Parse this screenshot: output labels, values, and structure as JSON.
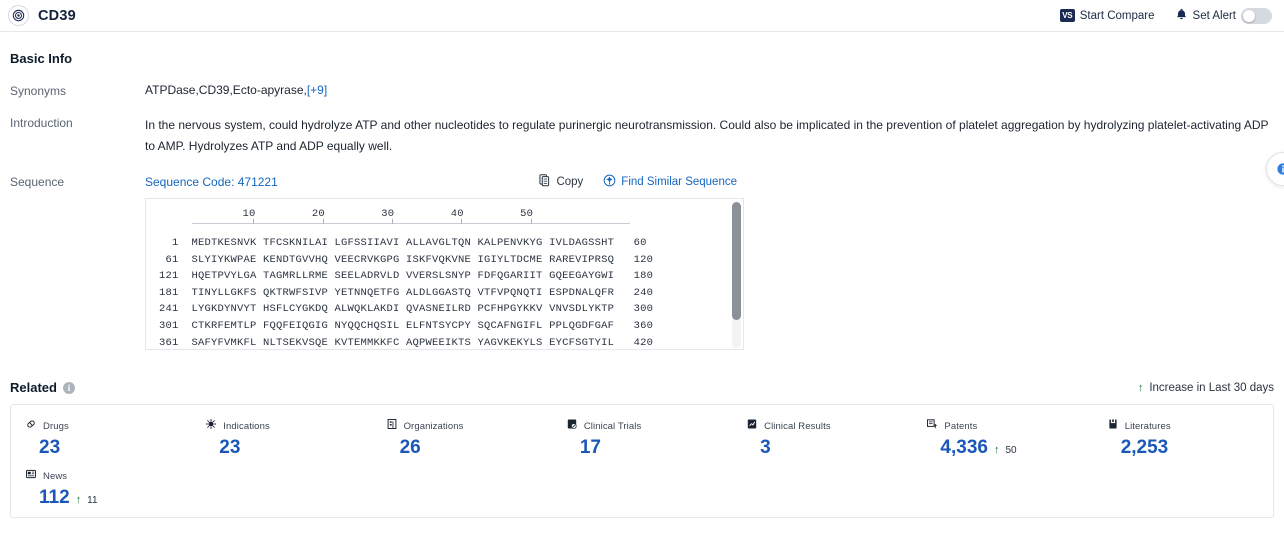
{
  "header": {
    "logo_icon": "target-icon",
    "title": "CD39",
    "actions": [
      {
        "icon": "vs-badge-icon",
        "badge_text": "VS",
        "label": "Start Compare"
      },
      {
        "icon": "bell-alert-icon",
        "label": "Set Alert",
        "toggle_on": false
      }
    ]
  },
  "basic_info": {
    "section_title": "Basic Info",
    "synonyms": {
      "label": "Synonyms",
      "value": "ATPDase,CD39,Ecto-apyrase,",
      "more": "[+9]"
    },
    "introduction": {
      "label": "Introduction",
      "text": "In the nervous system, could hydrolyze ATP and other nucleotides to regulate purinergic neurotransmission. Could also be implicated in the prevention of platelet aggregation by hydrolyzing platelet-activating ADP to AMP. Hydrolyzes ATP and ADP equally well."
    },
    "sequence": {
      "label": "Sequence",
      "code_label": "Sequence Code: 471221",
      "copy_label": "Copy",
      "find_similar_label": "Find Similar Sequence",
      "ruler_ticks": [
        "10",
        "20",
        "30",
        "40",
        "50"
      ],
      "rows": [
        {
          "start": "1",
          "blocks": [
            "MEDTKESNVK",
            "TFCSKNILAI",
            "LGFSSIIAVI",
            "ALLAVGLTQN",
            "KALPENVKYG",
            "IVLDAGSSHT"
          ],
          "end": "60"
        },
        {
          "start": "61",
          "blocks": [
            "SLYIYKWPAE",
            "KENDTGVVHQ",
            "VEECRVKGPG",
            "ISKFVQKVNE",
            "IGIYLTDCME",
            "RAREVIPRSQ"
          ],
          "end": "120"
        },
        {
          "start": "121",
          "blocks": [
            "HQETPVYLGA",
            "TAGMRLLRME",
            "SEELADRVLD",
            "VVERSLSNYP",
            "FDFQGARIIT",
            "GQEEGAYGWI"
          ],
          "end": "180"
        },
        {
          "start": "181",
          "blocks": [
            "TINYLLGKFS",
            "QKTRWFSIVP",
            "YETNNQETFG",
            "ALDLGGASTQ",
            "VTFVPQNQTI",
            "ESPDNALQFR"
          ],
          "end": "240"
        },
        {
          "start": "241",
          "blocks": [
            "LYGKDYNVYT",
            "HSFLCYGKDQ",
            "ALWQKLAKDI",
            "QVASNEILRD",
            "PCFHPGYKKV",
            "VNVSDLYKTP"
          ],
          "end": "300"
        },
        {
          "start": "301",
          "blocks": [
            "CTKRFEMTLP",
            "FQQFEIQGIG",
            "NYQQCHQSIL",
            "ELFNTSYCPY",
            "SQCAFNGIFL",
            "PPLQGDFGAF"
          ],
          "end": "360"
        },
        {
          "start": "361",
          "blocks": [
            "SAFYFVMKFL",
            "NLTSEKVSQE",
            "KVTEMMKKFC",
            "AQPWEEIKTS",
            "YAGVKEKYLS",
            "EYCFSGTYIL"
          ],
          "end": "420"
        }
      ]
    }
  },
  "related": {
    "title": "Related",
    "info_icon": "info-icon",
    "legend": {
      "arrow": "↑",
      "text": "Increase in Last 30 days"
    },
    "stats": [
      {
        "icon": "capsule-icon",
        "label": "Drugs",
        "value": "23",
        "delta": ""
      },
      {
        "icon": "virus-icon",
        "label": "Indications",
        "value": "23",
        "delta": ""
      },
      {
        "icon": "building-icon",
        "label": "Organizations",
        "value": "26",
        "delta": ""
      },
      {
        "icon": "clipboard-trial-icon",
        "label": "Clinical Trials",
        "value": "17",
        "delta": ""
      },
      {
        "icon": "clipboard-chart-icon",
        "label": "Clinical Results",
        "value": "3",
        "delta": ""
      },
      {
        "icon": "patent-icon",
        "label": "Patents",
        "value": "4,336",
        "delta": "50"
      },
      {
        "icon": "book-icon",
        "label": "Literatures",
        "value": "2,253",
        "delta": ""
      },
      {
        "icon": "news-icon",
        "label": "News",
        "value": "112",
        "delta": "11"
      }
    ]
  },
  "colors": {
    "accent_blue": "#1a57b8",
    "link_blue": "#1566c0",
    "up_green": "#1a7a3c",
    "dark_navy": "#14213d"
  }
}
